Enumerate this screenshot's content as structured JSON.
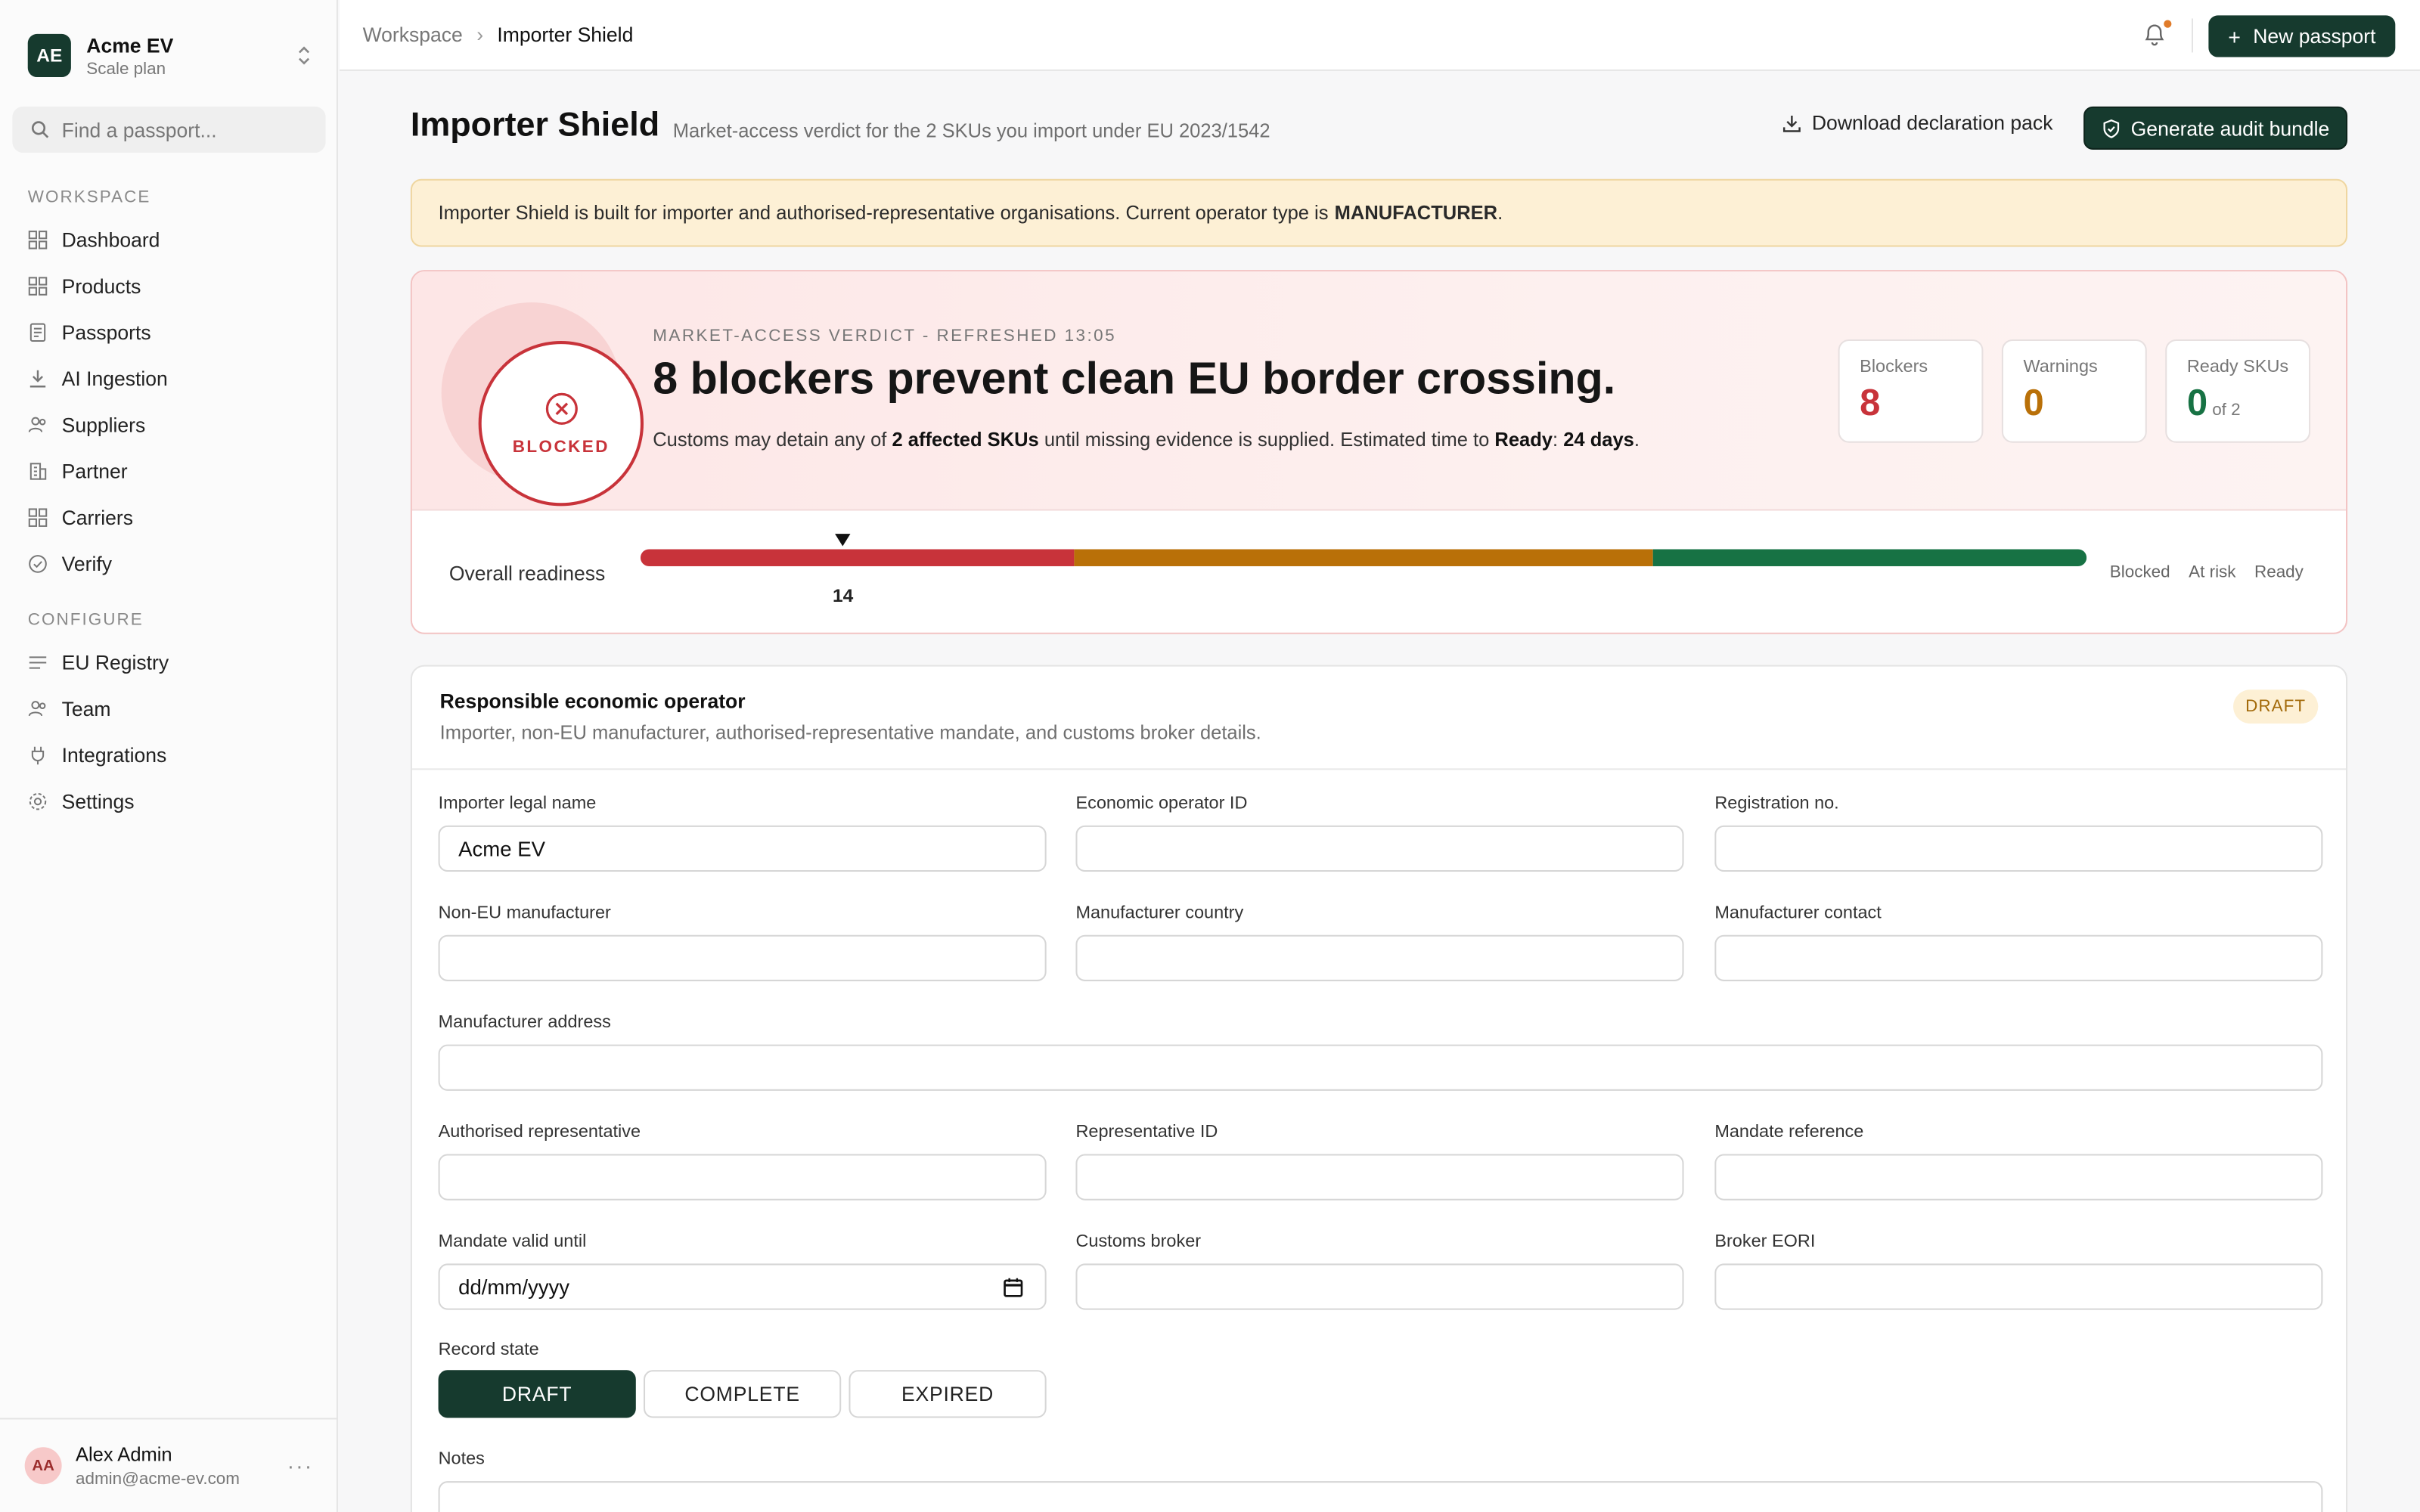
{
  "workspace": {
    "initials": "AE",
    "name": "Acme EV",
    "plan": "Scale plan"
  },
  "search": {
    "placeholder": "Find a passport..."
  },
  "sidebar": {
    "workspace_label": "WORKSPACE",
    "workspace_items": [
      {
        "label": "Dashboard",
        "icon": "grid-icon"
      },
      {
        "label": "Products",
        "icon": "grid-icon"
      },
      {
        "label": "Passports",
        "icon": "document-icon"
      },
      {
        "label": "AI Ingestion",
        "icon": "download-icon"
      },
      {
        "label": "Suppliers",
        "icon": "users-icon"
      },
      {
        "label": "Partner",
        "icon": "building-icon"
      },
      {
        "label": "Carriers",
        "icon": "grid-icon"
      },
      {
        "label": "Verify",
        "icon": "check-circle-icon"
      }
    ],
    "configure_label": "CONFIGURE",
    "configure_items": [
      {
        "label": "EU Registry",
        "icon": "list-icon"
      },
      {
        "label": "Team",
        "icon": "users-icon"
      },
      {
        "label": "Integrations",
        "icon": "plug-icon"
      },
      {
        "label": "Settings",
        "icon": "gear-icon"
      }
    ]
  },
  "user": {
    "initials": "AA",
    "name": "Alex Admin",
    "email": "admin@acme-ev.com"
  },
  "topbar": {
    "breadcrumb": [
      "Workspace",
      "Importer Shield"
    ],
    "new_passport": "New passport"
  },
  "page": {
    "title": "Importer Shield",
    "subtitle": "Market-access verdict for the 2 SKUs you import under EU 2023/1542",
    "download_label": "Download declaration pack",
    "audit_label": "Generate audit bundle"
  },
  "alert": {
    "text": "Importer Shield is built for importer and authorised-representative organisations. Current operator type is",
    "operator_type": "MANUFACTURER",
    "suffix": "."
  },
  "verdict": {
    "status": "BLOCKED",
    "meta": "MARKET-ACCESS VERDICT - REFRESHED 13:05",
    "headline": "8 blockers prevent clean EU border crossing.",
    "desc_1": "Customs may detain any of",
    "affected": "2 affected SKUs",
    "desc_2": "until missing evidence is supplied. Estimated time to",
    "ready_word": "Ready",
    "colon": ":",
    "days": "24 days",
    "period": ".",
    "stats": [
      {
        "label": "Blockers",
        "value": "8",
        "suffix": "",
        "color": "#c8333a"
      },
      {
        "label": "Warnings",
        "value": "0",
        "suffix": "",
        "color": "#b97008"
      },
      {
        "label": "Ready SKUs",
        "value": "0",
        "suffix": "of 2",
        "color": "#177244"
      }
    ],
    "readiness_label": "Overall readiness",
    "readiness_value": 14,
    "readiness_text": "14",
    "segments": {
      "blocked": 0.3,
      "at_risk": 0.4,
      "ready": 0.3
    },
    "legend": [
      "Blocked",
      "At risk",
      "Ready"
    ],
    "colors": {
      "blocked": "#c8333a",
      "at_risk": "#b97008",
      "ready": "#177244"
    }
  },
  "operator": {
    "title": "Responsible economic operator",
    "subtitle": "Importer, non-EU manufacturer, authorised-representative mandate, and customs broker details.",
    "badge": "DRAFT",
    "fields": {
      "importer_name": {
        "label": "Importer legal name",
        "value": "Acme EV"
      },
      "eo_id": {
        "label": "Economic operator ID",
        "value": ""
      },
      "reg_no": {
        "label": "Registration no.",
        "value": ""
      },
      "non_eu_mfr": {
        "label": "Non-EU manufacturer",
        "value": ""
      },
      "mfr_country": {
        "label": "Manufacturer country",
        "value": ""
      },
      "mfr_contact": {
        "label": "Manufacturer contact",
        "value": ""
      },
      "mfr_address": {
        "label": "Manufacturer address",
        "value": ""
      },
      "auth_rep": {
        "label": "Authorised representative",
        "value": ""
      },
      "rep_id": {
        "label": "Representative ID",
        "value": ""
      },
      "mandate_ref": {
        "label": "Mandate reference",
        "value": ""
      },
      "mandate_until": {
        "label": "Mandate valid until",
        "value": "dd/mm/yyyy"
      },
      "customs_broker": {
        "label": "Customs broker",
        "value": ""
      },
      "broker_eori": {
        "label": "Broker EORI",
        "value": ""
      }
    },
    "record_state_label": "Record state",
    "record_states": [
      "DRAFT",
      "COMPLETE",
      "EXPIRED"
    ],
    "record_state_selected": "DRAFT",
    "notes_label": "Notes"
  }
}
